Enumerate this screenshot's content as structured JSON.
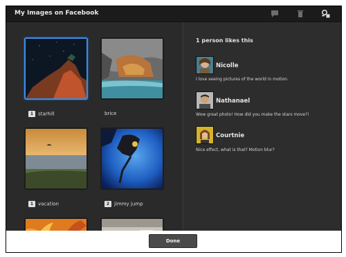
{
  "window": {
    "title": "My Images on Facebook"
  },
  "toolbar": {
    "icons": [
      "comment-icon",
      "trash-icon",
      "settings-icon"
    ]
  },
  "images": [
    {
      "name": "starhill",
      "comments": "1",
      "selected": true
    },
    {
      "name": "brice",
      "comments": "",
      "selected": false
    },
    {
      "name": "vacation",
      "comments": "1",
      "selected": false
    },
    {
      "name": "jimmy jump",
      "comments": "2",
      "selected": false
    }
  ],
  "likes": {
    "heading": "1 person likes this"
  },
  "comments": [
    {
      "user": "Nicolle",
      "text": "I love seeing pictures of the world in motion."
    },
    {
      "user": "Nathanael",
      "text": "Wow great photo! How did you make the stars move?!"
    },
    {
      "user": "Courtnie",
      "text": "Nice effect, what is that? Motion blur?"
    }
  ],
  "footer": {
    "done_label": "Done"
  }
}
